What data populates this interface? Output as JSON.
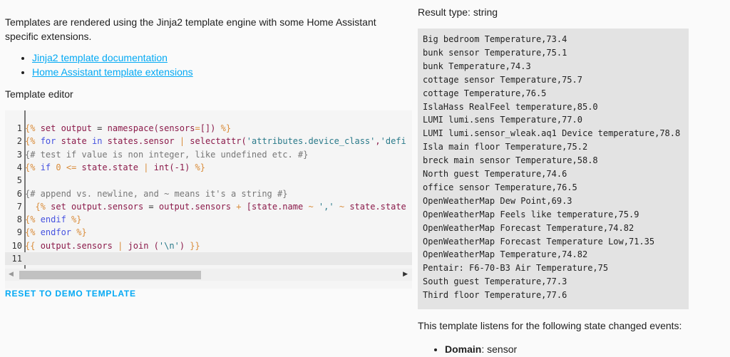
{
  "intro": "Templates are rendered using the Jinja2 template engine with some Home Assistant specific extensions.",
  "links": [
    "Jinja2 template documentation",
    "Home Assistant template extensions"
  ],
  "editor_label": "Template editor",
  "code_lines": [
    [
      [
        "d",
        "{%"
      ],
      [
        "p",
        " "
      ],
      [
        "v",
        "set output"
      ],
      [
        "p",
        " = "
      ],
      [
        "v",
        "namespace(sensors"
      ],
      [
        "d",
        "="
      ],
      [
        "v",
        "[]) "
      ],
      [
        "d",
        "%}"
      ]
    ],
    [
      [
        "d",
        "{%"
      ],
      [
        "p",
        " "
      ],
      [
        "k",
        "for"
      ],
      [
        "p",
        " "
      ],
      [
        "v",
        "state"
      ],
      [
        "p",
        " "
      ],
      [
        "k",
        "in"
      ],
      [
        "p",
        " "
      ],
      [
        "v",
        "states.sensor"
      ],
      [
        "p",
        " "
      ],
      [
        "d",
        "|"
      ],
      [
        "p",
        " "
      ],
      [
        "v",
        "selectattr("
      ],
      [
        "s",
        "'attributes.device_class'"
      ],
      [
        "v",
        ","
      ],
      [
        "s",
        "'defi"
      ]
    ],
    [
      [
        "c",
        "{# test if value is non integer, like undefined etc. #}"
      ]
    ],
    [
      [
        "d",
        "{%"
      ],
      [
        "p",
        " "
      ],
      [
        "k",
        "if"
      ],
      [
        "p",
        " "
      ],
      [
        "d",
        "0"
      ],
      [
        "p",
        " "
      ],
      [
        "d",
        "<="
      ],
      [
        "p",
        " "
      ],
      [
        "v",
        "state.state"
      ],
      [
        "p",
        " "
      ],
      [
        "d",
        "|"
      ],
      [
        "p",
        " "
      ],
      [
        "v",
        "int(-1) "
      ],
      [
        "d",
        "%}"
      ]
    ],
    [],
    [
      [
        "c",
        "{# append vs. newline, and ~ means it's a string #}"
      ]
    ],
    [
      [
        "p",
        "  "
      ],
      [
        "d",
        "{%"
      ],
      [
        "p",
        " "
      ],
      [
        "v",
        "set output.sensors"
      ],
      [
        "p",
        " = "
      ],
      [
        "v",
        "output.sensors"
      ],
      [
        "p",
        " "
      ],
      [
        "d",
        "+"
      ],
      [
        "p",
        " "
      ],
      [
        "v",
        "[state.name"
      ],
      [
        "p",
        " "
      ],
      [
        "d",
        "~"
      ],
      [
        "p",
        " "
      ],
      [
        "s",
        "','"
      ],
      [
        "p",
        " "
      ],
      [
        "d",
        "~"
      ],
      [
        "p",
        " "
      ],
      [
        "v",
        "state.state"
      ]
    ],
    [
      [
        "d",
        "{%"
      ],
      [
        "p",
        " "
      ],
      [
        "k",
        "endif"
      ],
      [
        "p",
        " "
      ],
      [
        "d",
        "%}"
      ]
    ],
    [
      [
        "d",
        "{%"
      ],
      [
        "p",
        " "
      ],
      [
        "k",
        "endfor"
      ],
      [
        "p",
        " "
      ],
      [
        "d",
        "%}"
      ]
    ],
    [
      [
        "d",
        "{{"
      ],
      [
        "p",
        " "
      ],
      [
        "v",
        "output.sensors"
      ],
      [
        "p",
        " "
      ],
      [
        "d",
        "|"
      ],
      [
        "p",
        " "
      ],
      [
        "v",
        "join ("
      ],
      [
        "s",
        "'\\n'"
      ],
      [
        "v",
        ") "
      ],
      [
        "d",
        "}}"
      ]
    ],
    []
  ],
  "reset_label": "RESET TO DEMO TEMPLATE",
  "result_type": "Result type: string",
  "result_lines": [
    "Big bedroom Temperature,73.4",
    "bunk sensor Temperature,75.1",
    "bunk Temperature,74.3",
    "cottage sensor Temperature,75.7",
    "cottage Temperature,76.5",
    "IslaHass RealFeel temperature,85.0",
    "LUMI lumi.sens Temperature,77.0",
    "LUMI lumi.sensor_wleak.aq1 Device temperature,78.8",
    "Isla main floor Temperature,75.2",
    "breck main sensor Temperature,58.8",
    "North guest Temperature,74.6",
    "office sensor Temperature,76.5",
    "OpenWeatherMap Dew Point,69.3",
    "OpenWeatherMap Feels like temperature,75.9",
    "OpenWeatherMap Forecast Temperature,74.82",
    "OpenWeatherMap Forecast Temperature Low,71.35",
    "OpenWeatherMap Temperature,74.82",
    "Pentair: F6-70-B3 Air Temperature,75",
    "South guest Temperature,77.3",
    "Third floor Temperature,77.6"
  ],
  "listens_text": "This template listens for the following state changed events:",
  "domain_label": "Domain",
  "domain_value": ": sensor"
}
